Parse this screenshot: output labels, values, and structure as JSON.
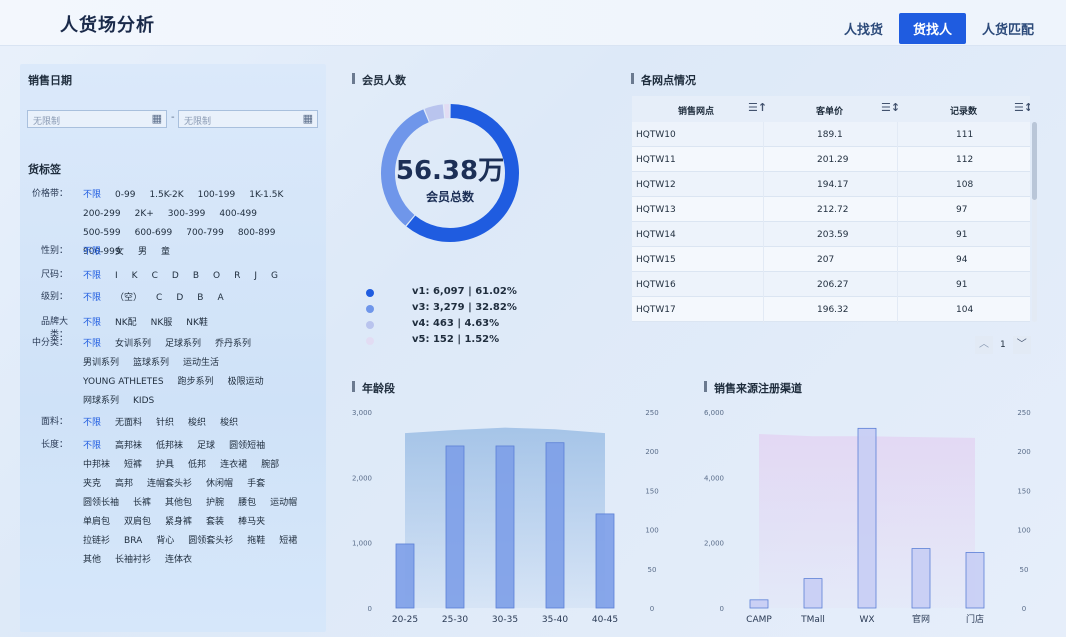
{
  "header": {
    "title": "人货场分析",
    "tabs": [
      {
        "label": "人找货",
        "active": false
      },
      {
        "label": "货找人",
        "active": true
      },
      {
        "label": "人货匹配",
        "active": false
      }
    ]
  },
  "filters": {
    "date_title": "销售日期",
    "date_start_placeholder": "无限制",
    "date_end_placeholder": "无限制",
    "date_separator": "-",
    "tag_title": "货标签",
    "rows": [
      {
        "label": "价格带：",
        "options": [
          "不限",
          "0-99",
          "1.5K-2K",
          "100-199",
          "1K-1.5K",
          "200-299",
          "2K+",
          "300-399",
          "400-499",
          "500-599",
          "600-699",
          "700-799",
          "800-899",
          "900-999"
        ]
      },
      {
        "label": "性别：",
        "options": [
          "不限",
          "女",
          "男",
          "童"
        ]
      },
      {
        "label": "尺码：",
        "options": [
          "不限",
          "I",
          "K",
          "C",
          "D",
          "B",
          "O",
          "R",
          "J",
          "G"
        ]
      },
      {
        "label": "级别：",
        "options": [
          "不限",
          "（空）",
          "C",
          "D",
          "B",
          "A"
        ]
      },
      {
        "label": "品牌大类：",
        "options": [
          "不限",
          "NK配",
          "NK服",
          "NK鞋"
        ]
      },
      {
        "label": "中分类：",
        "options": [
          "不限",
          "女训系列",
          "足球系列",
          "乔丹系列",
          "男训系列",
          "篮球系列",
          "运动生活",
          "YOUNG ATHLETES",
          "跑步系列",
          "极限运动",
          "网球系列",
          "KIDS"
        ]
      },
      {
        "label": "面料：",
        "options": [
          "不限",
          "无面料",
          "针织",
          "梭织",
          "梭织"
        ]
      },
      {
        "label": "长度：",
        "options": [
          "不限",
          "高邦袜",
          "低邦袜",
          "足球",
          "圆领短袖",
          "中邦袜",
          "短裤",
          "护具",
          "低邦",
          "连衣裙",
          "腕部",
          "夹克",
          "高邦",
          "连帽套头衫",
          "休闲帽",
          "手套",
          "圆领长袖",
          "长裤",
          "其他包",
          "护腕",
          "腰包",
          "运动帽",
          "单肩包",
          "双肩包",
          "紧身裤",
          "套装",
          "棒马夹",
          "拉链衫",
          "BRA",
          "背心",
          "圆领套头衫",
          "拖鞋",
          "短裙",
          "其他",
          "长袖衬衫",
          "连体衣"
        ]
      }
    ]
  },
  "members": {
    "title": "会员人数",
    "total_value": "56.38万",
    "total_label": "会员总数",
    "legend": [
      {
        "name": "v1",
        "text": "v1:  6,097  |   61.02%",
        "color": "#1f5ce0",
        "pct": 61.02
      },
      {
        "name": "v3",
        "text": "v3:  3,279  |   32.82%",
        "color": "#6f96ea",
        "pct": 32.82
      },
      {
        "name": "v4",
        "text": "v4:   463  |   4.63%",
        "color": "#b9c4ee",
        "pct": 4.63
      },
      {
        "name": "v5",
        "text": "v5:   152  |   1.52%",
        "color": "#e2dcf3",
        "pct": 1.52
      }
    ]
  },
  "outlets": {
    "title": "各网点情况",
    "columns": [
      "销售网点",
      "客单价",
      "记录数"
    ],
    "rows": [
      [
        "HQTW10",
        "189.1",
        "111"
      ],
      [
        "HQTW11",
        "201.29",
        "112"
      ],
      [
        "HQTW12",
        "194.17",
        "108"
      ],
      [
        "HQTW13",
        "212.72",
        "97"
      ],
      [
        "HQTW14",
        "203.59",
        "91"
      ],
      [
        "HQTW15",
        "207",
        "94"
      ],
      [
        "HQTW16",
        "206.27",
        "91"
      ],
      [
        "HQTW17",
        "196.32",
        "104"
      ]
    ],
    "page": "1",
    "prev_icon": "︿",
    "next_icon": "﹀"
  },
  "chart_data": [
    {
      "type": "bar",
      "title": "年龄段",
      "categories": [
        "20-25",
        "25-30",
        "30-35",
        "35-40",
        "40-45"
      ],
      "ylim": [
        0,
        3000
      ],
      "yticks": [
        "3,000",
        "2,000",
        "1,000",
        "0"
      ],
      "y2lim": [
        0,
        250
      ],
      "y2ticks": [
        "250",
        "200",
        "150",
        "100",
        "50",
        "0"
      ],
      "series": [
        {
          "values": [
            980,
            2480,
            2480,
            2530,
            1440
          ]
        },
        {
          "type": "area",
          "values": [
            223,
            227,
            230,
            228,
            223
          ]
        }
      ],
      "colors": {
        "bar": "#7d9fe8",
        "area": "#9fc0e6"
      }
    },
    {
      "type": "bar",
      "title": "销售来源注册渠道",
      "categories": [
        "CAMP",
        "TMall",
        "WX",
        "官网",
        "门店"
      ],
      "ylim": [
        0,
        6000
      ],
      "yticks": [
        "6,000",
        "4,000",
        "2,000",
        "0"
      ],
      "y2lim": [
        0,
        250
      ],
      "y2ticks": [
        "250",
        "200",
        "150",
        "100",
        "50",
        "0"
      ],
      "series": [
        {
          "values": [
            250,
            900,
            5500,
            1820,
            1700
          ]
        },
        {
          "type": "area",
          "values": [
            222,
            219,
            219,
            218,
            217
          ]
        }
      ],
      "colors": {
        "bar": "#c7cdf4",
        "area": "#e3d6f3"
      }
    }
  ]
}
